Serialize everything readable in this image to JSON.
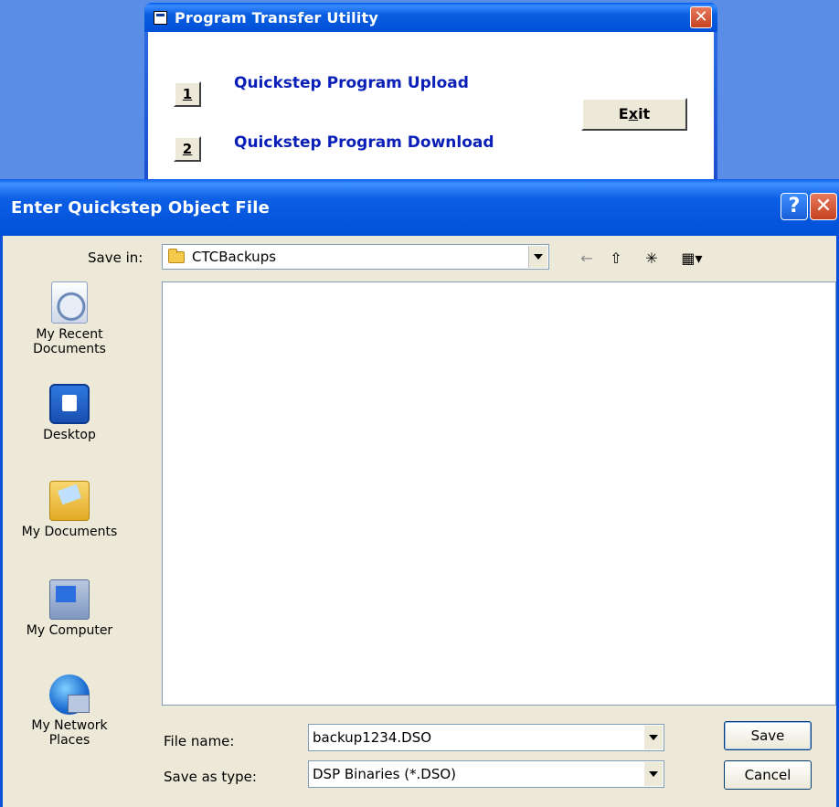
{
  "background_window": {
    "title": "Program Transfer Utility",
    "close_glyph": "✕",
    "options": [
      {
        "number": "1",
        "label": "Quickstep Program Upload"
      },
      {
        "number": "2",
        "label": "Quickstep Program Download"
      }
    ],
    "exit_prefix": "E",
    "exit_mnemonic": "x",
    "exit_suffix": "it"
  },
  "dialog": {
    "title": "Enter Quickstep Object File",
    "help_glyph": "?",
    "close_glyph": "✕",
    "save_in_label": "Save in:",
    "save_in_value": "CTCBackups",
    "toolbar": {
      "back_icon": "←",
      "up_icon": "⇧",
      "new_folder_icon": "✳",
      "views_icon": "▦▾"
    },
    "places": [
      {
        "line1": "My Recent",
        "line2": "Documents"
      },
      {
        "line1": "Desktop",
        "line2": ""
      },
      {
        "line1": "My Documents",
        "line2": ""
      },
      {
        "line1": "My Computer",
        "line2": ""
      },
      {
        "line1": "My Network",
        "line2": "Places"
      }
    ],
    "file_name_label": "File name:",
    "file_name_value": "backup1234.DSO",
    "save_as_type_label": "Save as type:",
    "save_as_type_value": "DSP Binaries (*.DSO)",
    "save_button": "Save",
    "cancel_button": "Cancel"
  },
  "colors": {
    "titlebar": "#0050d8",
    "option_text": "#0a1fb8",
    "dialog_face": "#ece9d8"
  }
}
